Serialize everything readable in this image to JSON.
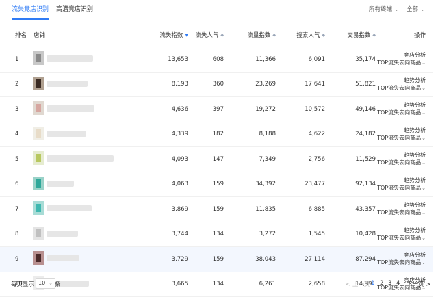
{
  "tabs": [
    {
      "label": "流失竞店识别",
      "active": true
    },
    {
      "label": "高潜竞店识别",
      "active": false
    }
  ],
  "filters": {
    "terminal": "所有终端",
    "scope": "全部"
  },
  "table": {
    "headers": {
      "rank": "排名",
      "shop": "店铺",
      "loss_index": "流失指数",
      "loss_pop": "流失人气",
      "traffic_index": "流量指数",
      "search_pop": "搜索人气",
      "trade_index": "交易指数",
      "ops": "操作"
    },
    "rows": [
      {
        "rank": "1",
        "loss_index": "13,653",
        "loss_pop": "608",
        "traffic_index": "11,366",
        "search_pop": "6,091",
        "trade_index": "35,174",
        "op1": "竞店分析",
        "op2": "TOP流失去向商品",
        "thumb": [
          "#8a8a8a",
          "#c8c8c8"
        ]
      },
      {
        "rank": "2",
        "loss_index": "8,193",
        "loss_pop": "360",
        "traffic_index": "23,269",
        "search_pop": "17,641",
        "trade_index": "51,821",
        "op1": "趋势分析",
        "op2": "TOP流失去向商品",
        "thumb": [
          "#3a2a22",
          "#b0a090"
        ]
      },
      {
        "rank": "3",
        "loss_index": "4,636",
        "loss_pop": "397",
        "traffic_index": "19,272",
        "search_pop": "10,572",
        "trade_index": "49,146",
        "op1": "趋势分析",
        "op2": "TOP流失去向商品",
        "thumb": [
          "#d6a6a0",
          "#e0d8d0"
        ]
      },
      {
        "rank": "4",
        "loss_index": "4,339",
        "loss_pop": "182",
        "traffic_index": "8,188",
        "search_pop": "4,622",
        "trade_index": "24,182",
        "op1": "趋势分析",
        "op2": "TOP流失去向商品",
        "thumb": [
          "#e8dcc8",
          "#f0eee6"
        ]
      },
      {
        "rank": "5",
        "loss_index": "4,093",
        "loss_pop": "147",
        "traffic_index": "7,349",
        "search_pop": "2,756",
        "trade_index": "11,529",
        "op1": "趋势分析",
        "op2": "TOP流失去向商品",
        "thumb": [
          "#b8c860",
          "#e6ecd0"
        ]
      },
      {
        "rank": "6",
        "loss_index": "4,063",
        "loss_pop": "159",
        "traffic_index": "34,392",
        "search_pop": "23,477",
        "trade_index": "92,134",
        "op1": "趋势分析",
        "op2": "TOP流失去向商品",
        "thumb": [
          "#2fa89a",
          "#9ad2c8"
        ]
      },
      {
        "rank": "7",
        "loss_index": "3,869",
        "loss_pop": "159",
        "traffic_index": "11,835",
        "search_pop": "6,885",
        "trade_index": "43,357",
        "op1": "趋势分析",
        "op2": "TOP流失去向商品",
        "thumb": [
          "#3fb8b0",
          "#a8dcd6"
        ]
      },
      {
        "rank": "8",
        "loss_index": "3,744",
        "loss_pop": "134",
        "traffic_index": "3,272",
        "search_pop": "1,545",
        "trade_index": "10,428",
        "op1": "趋势分析",
        "op2": "TOP流失去向商品",
        "thumb": [
          "#c0c0c0",
          "#e4e4e4"
        ]
      },
      {
        "rank": "9",
        "loss_index": "3,729",
        "loss_pop": "159",
        "traffic_index": "38,043",
        "search_pop": "27,114",
        "trade_index": "87,294",
        "op1": "竞店分析",
        "op2": "TOP流失去向商品",
        "thumb": [
          "#4a2a2a",
          "#b89090"
        ],
        "highlight": true
      },
      {
        "rank": "10",
        "loss_index": "3,665",
        "loss_pop": "134",
        "traffic_index": "6,261",
        "search_pop": "2,658",
        "trade_index": "14,991",
        "op1": "竞店分析",
        "op2": "TOP流失去向商品",
        "thumb": [
          "#d0d0d0",
          "#ececec"
        ]
      }
    ]
  },
  "pagination": {
    "per_page_label": "每页显示",
    "per_page_value": "10",
    "per_page_unit": "条",
    "prev": "< 上一页",
    "pages": [
      "1",
      "2",
      "3",
      "4"
    ],
    "current": "1",
    "next": "下一页 >"
  },
  "colors": {
    "accent": "#2f7bf5",
    "row_highlight": "#f3f7fe"
  }
}
